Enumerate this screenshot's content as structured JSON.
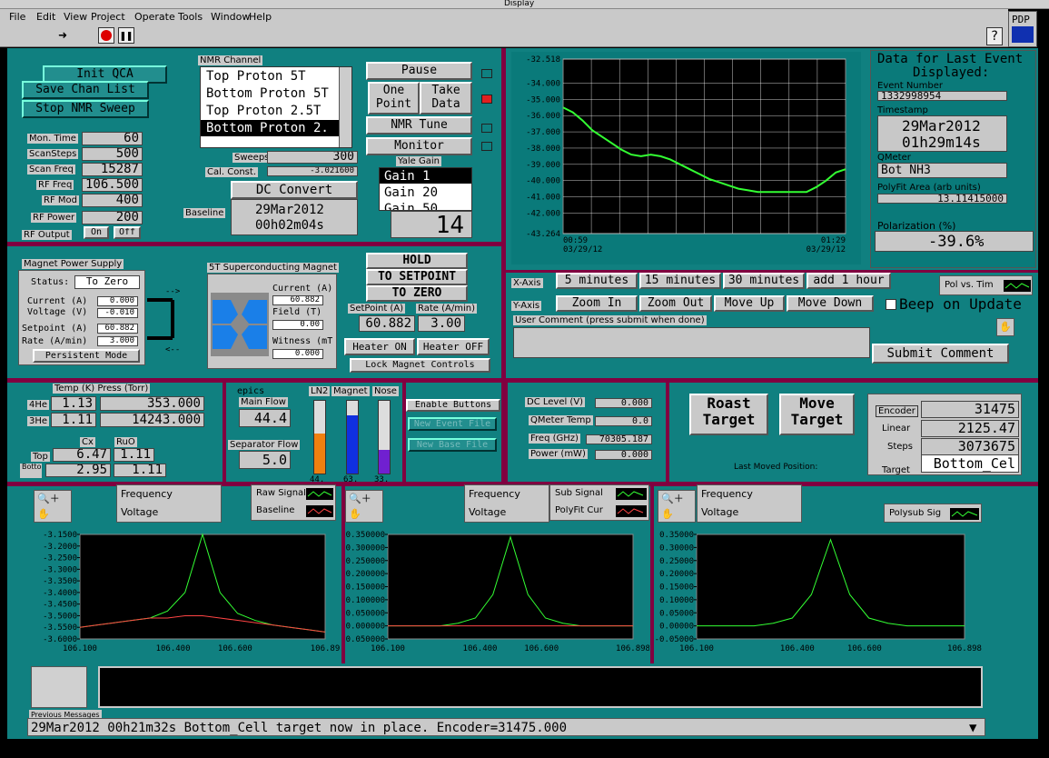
{
  "window": {
    "title": "Display"
  },
  "menu": [
    "File",
    "Edit",
    "View",
    "Project",
    "Operate",
    "Tools",
    "Window",
    "Help"
  ],
  "toolbar": {
    "pdp": "PDP",
    "help": "?"
  },
  "left_buttons": {
    "init": "Init QCA",
    "save": "Save Chan List",
    "stop": "Stop NMR Sweep"
  },
  "params": [
    {
      "label": "Mon. Time",
      "value": "60"
    },
    {
      "label": "ScanSteps",
      "value": "500"
    },
    {
      "label": "Scan Freq",
      "value": "15287"
    },
    {
      "label": "RF Freq",
      "value": "106.500"
    },
    {
      "label": "RF Mod",
      "value": "400"
    },
    {
      "label": "RF Power",
      "value": "200"
    }
  ],
  "rf_output": {
    "label": "RF Output",
    "on": "On",
    "off": "Off"
  },
  "nmr": {
    "title": "NMR Channel",
    "channels": [
      "Top Proton 5T",
      "Bottom Proton 5T",
      "Top Proton 2.5T",
      "Bottom Proton 2."
    ],
    "selected": 3,
    "sweeps_label": "Sweeps",
    "sweeps": "300",
    "cal_label": "Cal. Const.",
    "cal": "-3.021600",
    "dc_convert": "DC Convert",
    "baseline_label": "Baseline",
    "baseline_date": "29Mar2012",
    "baseline_time": "00h02m04s"
  },
  "controls": {
    "pause": "Pause",
    "one_point_1": "One",
    "one_point_2": "Point",
    "take_1": "Take",
    "take_2": "Data",
    "nmr_tune": "NMR Tune",
    "monitor": "Monitor",
    "yale_gain": "Yale Gain",
    "gains": [
      "Gain 1",
      "Gain 20",
      "Gain 50"
    ],
    "gain_value": "14"
  },
  "trend": {
    "yticks": [
      "-32.518",
      "-34.000",
      "-35.000",
      "-36.000",
      "-37.000",
      "-38.000",
      "-39.000",
      "-40.000",
      "-41.000",
      "-42.000",
      "-43.264"
    ],
    "xstart_1": "00:59",
    "xstart_2": "03/29/12",
    "xend_1": "01:29",
    "xend_2": "03/29/12",
    "x_axis_label": "X-Axis",
    "x_buttons": [
      "5 minutes",
      "15 minutes",
      "30 minutes",
      "add 1 hour"
    ],
    "y_axis_label": "Y-Axis",
    "y_buttons": [
      "Zoom In",
      "Zoom Out",
      "Move Up",
      "Move Down"
    ],
    "pol_vs_time": "Pol vs. Tim",
    "beep": "Beep on Update",
    "comment_label": "User Comment (press submit when done)",
    "comment": "",
    "submit": "Submit Comment"
  },
  "last_event": {
    "title_1": "Data for Last Event",
    "title_2": "Displayed:",
    "event_label": "Event Number",
    "event": "1332998954",
    "ts_label": "Timestamp",
    "date": "29Mar2012",
    "time": "01h29m14s",
    "qmeter_label": "QMeter",
    "qmeter": "Bot NH3",
    "polyfit_label": "PolyFit Area (arb units)",
    "polyfit": "13.11415000",
    "pol_label": "Polarization (%)",
    "pol": "-39.6%"
  },
  "magnet_ps": {
    "title": "Magnet Power Supply",
    "status_label": "Status:",
    "status": "To Zero",
    "current_label": "Current (A)",
    "current": "0.000",
    "voltage_label": "Voltage (V)",
    "voltage": "-0.010",
    "setpoint_label": "Setpoint (A)",
    "setpoint": "60.882",
    "rate_label": "Rate (A/min)",
    "rate": "3.000",
    "persistent": "Persistent Mode"
  },
  "sc_magnet": {
    "title": "5T Superconducting Magnet",
    "current_label": "Current (A)",
    "current": "60.882",
    "field_label": "Field (T)",
    "field": "0.00",
    "witness_label": "Witness (mT",
    "witness": "0.000"
  },
  "magnet_ctrl": {
    "hold": "HOLD",
    "to_setpoint": "TO SETPOINT",
    "to_zero": "TO ZERO",
    "setpoint_label": "SetPoint (A)",
    "rate_label": "Rate (A/min)",
    "setpoint": "60.882",
    "rate": "3.00",
    "heater_on": "Heater ON",
    "heater_off": "Heater OFF",
    "lock": "Lock Magnet Controls"
  },
  "temps": {
    "header": "Temp (K) Press (Torr)",
    "he4_label": "4He",
    "he4_t": "1.13",
    "he4_p": "353.000",
    "he3_label": "3He",
    "he3_t": "1.11",
    "he3_p": "14243.000",
    "cx_label": "Cx",
    "ruo_label": "RuO",
    "top_label": "Top",
    "top_cx": "6.47",
    "top_ruo": "1.11",
    "bot_label": "Bottom",
    "bot_cx": "2.95",
    "bot_ruo": "1.11"
  },
  "epics": {
    "title": "epics",
    "main_flow_label": "Main Flow",
    "main_flow": "44.4",
    "sep_flow_label": "Separator Flow",
    "sep_flow": "5.0",
    "bars": [
      {
        "label": "LN2",
        "value": "44.",
        "level": 0.55,
        "color": "#f08010"
      },
      {
        "label": "Magnet",
        "value": "63.",
        "level": 0.8,
        "color": "#1030e0"
      },
      {
        "label": "Nose",
        "value": "33.",
        "level": 0.33,
        "color": "#7020d0"
      }
    ]
  },
  "files": {
    "enable": "Enable Buttons",
    "new_event": "New Event File",
    "new_base": "New Base File"
  },
  "readouts": [
    {
      "label": "DC Level (V)",
      "value": "0.000"
    },
    {
      "label": "QMeter Temp",
      "value": "0.0"
    },
    {
      "label": "Freq (GHz)",
      "value": "70305.187"
    },
    {
      "label": "Power (mW)",
      "value": "0.000"
    }
  ],
  "target": {
    "roast_1": "Roast",
    "roast_2": "Target",
    "move_1": "Move",
    "move_2": "Target",
    "encoder_label": "Encoder",
    "encoder": "31475",
    "linear_label": "Linear",
    "linear": "2125.47",
    "steps_label": "Steps",
    "steps": "3073675",
    "target_label": "Target",
    "target": "Bottom_Cel",
    "last_moved": "Last Moved Position:"
  },
  "graph1": {
    "freq": "Frequency",
    "volt": "Voltage",
    "leg1": "Raw Signal",
    "leg2": "Baseline",
    "yticks": [
      "-3.1500",
      "-3.2000",
      "-3.2500",
      "-3.3000",
      "-3.3500",
      "-3.4000",
      "-3.4500",
      "-3.5000",
      "-3.5500",
      "-3.6000"
    ],
    "xticks": [
      "106.100",
      "106.400",
      "106.600",
      "106.89"
    ]
  },
  "graph2": {
    "freq": "Frequency",
    "volt": "Voltage",
    "leg1": "Sub Signal",
    "leg2": "PolyFit Cur",
    "yticks": [
      "0.350000",
      "0.300000",
      "0.250000",
      "0.200000",
      "0.150000",
      "0.100000",
      "0.050000",
      "0.000000",
      "-0.050000"
    ],
    "xticks": [
      "106.100",
      "106.400",
      "106.600",
      "106.898"
    ]
  },
  "graph3": {
    "freq": "Frequency",
    "volt": "Voltage",
    "leg1": "Polysub Sig",
    "yticks": [
      "0.35000",
      "0.30000",
      "0.25000",
      "0.20000",
      "0.15000",
      "0.10000",
      "0.05000",
      "0.00000",
      "-0.05000"
    ],
    "xticks": [
      "106.100",
      "106.400",
      "106.600",
      "106.898"
    ]
  },
  "messages": {
    "label": "Previous Messages",
    "text": "29Mar2012 00h21m32s Bottom_Cell target now in place.  Encoder=31475.000"
  },
  "chart_data": [
    {
      "type": "line",
      "title": "",
      "ylim": [
        -43.264,
        -32.518
      ],
      "x": [
        "00:59",
        "01:29"
      ],
      "series": [
        {
          "values": [
            -35.5,
            -35.8,
            -36.3,
            -36.9,
            -37.3,
            -37.7,
            -38.1,
            -38.4,
            -38.5,
            -38.4,
            -38.5,
            -38.7,
            -39.0,
            -39.3,
            -39.6,
            -39.9,
            -40.1,
            -40.3,
            -40.5,
            -40.6,
            -40.7,
            -40.7,
            -40.7,
            -40.7,
            -40.7,
            -40.7,
            -40.4,
            -40.0,
            -39.5,
            -39.3
          ]
        }
      ]
    },
    {
      "type": "line",
      "title": "",
      "xlim": [
        106.1,
        106.89
      ],
      "ylim": [
        -3.6,
        -3.15
      ],
      "series": [
        {
          "values": [
            -3.55,
            -3.54,
            -3.53,
            -3.52,
            -3.51,
            -3.48,
            -3.4,
            -3.15,
            -3.4,
            -3.49,
            -3.52,
            -3.54,
            -3.55,
            -3.56,
            -3.57
          ]
        },
        {
          "values": [
            -3.55,
            -3.54,
            -3.53,
            -3.52,
            -3.51,
            -3.51,
            -3.5,
            -3.5,
            -3.51,
            -3.52,
            -3.53,
            -3.54,
            -3.55,
            -3.56,
            -3.57
          ]
        }
      ]
    },
    {
      "type": "line",
      "title": "",
      "xlim": [
        106.1,
        106.898
      ],
      "ylim": [
        -0.05,
        0.35
      ],
      "series": [
        {
          "values": [
            0,
            0,
            0,
            0,
            0.01,
            0.03,
            0.12,
            0.34,
            0.12,
            0.03,
            0.01,
            0,
            0,
            0,
            0
          ]
        },
        {
          "values": [
            0,
            0,
            0,
            0,
            0,
            0,
            0,
            0,
            0,
            0,
            0,
            0,
            0,
            0,
            0
          ]
        }
      ]
    },
    {
      "type": "line",
      "title": "",
      "xlim": [
        106.1,
        106.898
      ],
      "ylim": [
        -0.05,
        0.35
      ],
      "series": [
        {
          "values": [
            0,
            0,
            0,
            0,
            0.01,
            0.03,
            0.12,
            0.33,
            0.12,
            0.03,
            0.01,
            0,
            0,
            0,
            0
          ]
        }
      ]
    }
  ]
}
